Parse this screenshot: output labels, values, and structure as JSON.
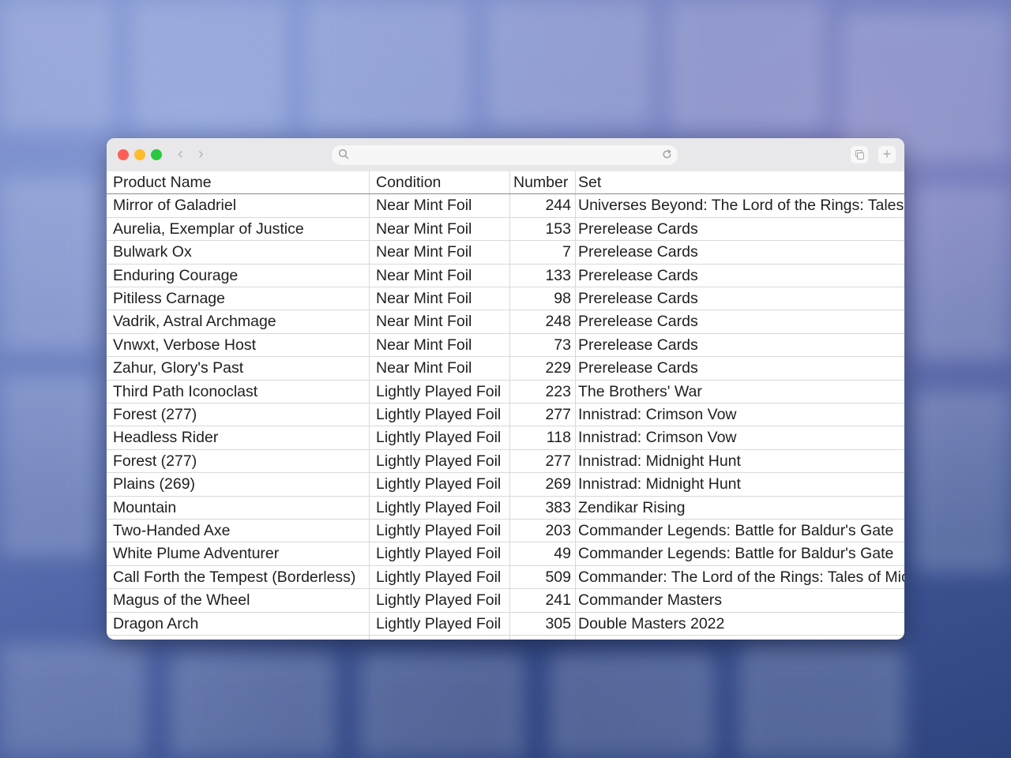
{
  "window": {
    "url_placeholder": ""
  },
  "table": {
    "headers": {
      "name": "Product Name",
      "condition": "Condition",
      "number": "Number",
      "set": "Set"
    },
    "rows": [
      {
        "name": "Mirror of Galadriel",
        "condition": "Near Mint Foil",
        "number": "244",
        "set": "Universes Beyond: The Lord of the Rings: Tales"
      },
      {
        "name": "Aurelia, Exemplar of Justice",
        "condition": "Near Mint Foil",
        "number": "153",
        "set": "Prerelease Cards"
      },
      {
        "name": "Bulwark Ox",
        "condition": "Near Mint Foil",
        "number": "7",
        "set": "Prerelease Cards"
      },
      {
        "name": "Enduring Courage",
        "condition": "Near Mint Foil",
        "number": "133",
        "set": "Prerelease Cards"
      },
      {
        "name": "Pitiless Carnage",
        "condition": "Near Mint Foil",
        "number": "98",
        "set": "Prerelease Cards"
      },
      {
        "name": "Vadrik, Astral Archmage",
        "condition": "Near Mint Foil",
        "number": "248",
        "set": "Prerelease Cards"
      },
      {
        "name": "Vnwxt, Verbose Host",
        "condition": "Near Mint Foil",
        "number": "73",
        "set": "Prerelease Cards"
      },
      {
        "name": "Zahur, Glory's Past",
        "condition": "Near Mint Foil",
        "number": "229",
        "set": "Prerelease Cards"
      },
      {
        "name": "Third Path Iconoclast",
        "condition": "Lightly Played Foil",
        "number": "223",
        "set": "The Brothers' War"
      },
      {
        "name": "Forest (277)",
        "condition": "Lightly Played Foil",
        "number": "277",
        "set": "Innistrad: Crimson Vow"
      },
      {
        "name": "Headless Rider",
        "condition": "Lightly Played Foil",
        "number": "118",
        "set": "Innistrad: Crimson Vow"
      },
      {
        "name": "Forest (277)",
        "condition": "Lightly Played Foil",
        "number": "277",
        "set": "Innistrad: Midnight Hunt"
      },
      {
        "name": "Plains (269)",
        "condition": "Lightly Played Foil",
        "number": "269",
        "set": "Innistrad: Midnight Hunt"
      },
      {
        "name": "Mountain",
        "condition": "Lightly Played Foil",
        "number": "383",
        "set": "Zendikar Rising"
      },
      {
        "name": "Two-Handed Axe",
        "condition": "Lightly Played Foil",
        "number": "203",
        "set": "Commander Legends: Battle for Baldur's Gate"
      },
      {
        "name": "White Plume Adventurer",
        "condition": "Lightly Played Foil",
        "number": "49",
        "set": "Commander Legends: Battle for Baldur's Gate"
      },
      {
        "name": "Call Forth the Tempest (Borderless)",
        "condition": "Lightly Played Foil",
        "number": "509",
        "set": "Commander: The Lord of the Rings: Tales of Mic"
      },
      {
        "name": "Magus of the Wheel",
        "condition": "Lightly Played Foil",
        "number": "241",
        "set": "Commander Masters"
      },
      {
        "name": "Dragon Arch",
        "condition": "Lightly Played Foil",
        "number": "305",
        "set": "Double Masters 2022"
      },
      {
        "name": "",
        "condition": "",
        "number": "",
        "set": ""
      }
    ]
  }
}
